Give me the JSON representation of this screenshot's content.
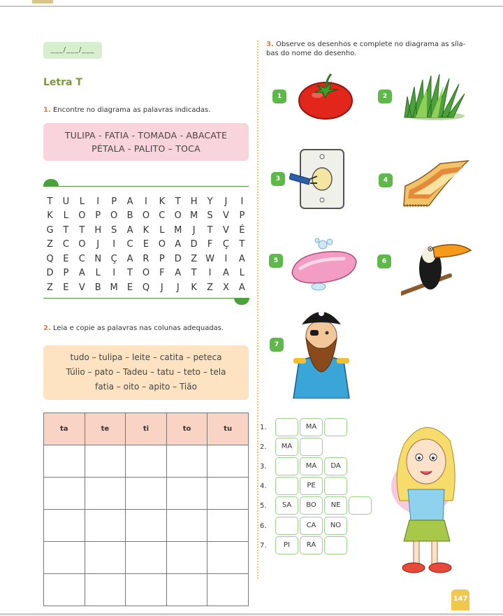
{
  "page": {
    "number": "147"
  },
  "header": {
    "date_placeholder": "___/___/___"
  },
  "section_title": "Letra T",
  "exercise1": {
    "number": "1.",
    "instruction": "Encontre no diagrama as palavras indicadas.",
    "words_line1": "TULIPA - FATIA - TOMADA - ABACATE",
    "words_line2": "PÉTALA - PALITO – TOCA",
    "grid": [
      [
        "T",
        "U",
        "L",
        "I",
        "P",
        "A",
        "I",
        "K",
        "T",
        "H",
        "Y",
        "J",
        "I"
      ],
      [
        "K",
        "L",
        "O",
        "P",
        "O",
        "B",
        "O",
        "C",
        "O",
        "M",
        "S",
        "V",
        "P"
      ],
      [
        "G",
        "T",
        "T",
        "H",
        "S",
        "A",
        "K",
        "L",
        "M",
        "J",
        "T",
        "V",
        "É"
      ],
      [
        "Z",
        "C",
        "O",
        "J",
        "I",
        "C",
        "E",
        "O",
        "A",
        "D",
        "F",
        "Ç",
        "T"
      ],
      [
        "Q",
        "E",
        "C",
        "N",
        "Ç",
        "A",
        "R",
        "P",
        "D",
        "Z",
        "W",
        "I",
        "A"
      ],
      [
        "D",
        "P",
        "A",
        "L",
        "I",
        "T",
        "O",
        "F",
        "A",
        "T",
        "I",
        "A",
        "L"
      ],
      [
        "Z",
        "E",
        "V",
        "B",
        "M",
        "E",
        "Q",
        "J",
        "J",
        "K",
        "Z",
        "X",
        "A"
      ]
    ]
  },
  "exercise2": {
    "number": "2.",
    "instruction": "Leia e copie as palavras nas colunas adequadas.",
    "words_line1": "tudo – tulipa – leite – catita – peteca",
    "words_line2": "Túlio – pato – Tadeu – tatu – teto – tela",
    "words_line3": "fatia – oito – apito – Tião",
    "columns": [
      "ta",
      "te",
      "ti",
      "to",
      "tu"
    ]
  },
  "exercise3": {
    "number": "3.",
    "instruction_line1": "Observe os desenhos e complete no diagrama as síla-",
    "instruction_line2": "bas do nome do desenho.",
    "picture_numbers": [
      "1",
      "2",
      "3",
      "4",
      "5",
      "6",
      "7"
    ],
    "pictures": [
      "tomato-illustration",
      "grass-illustration",
      "outlet-plug-illustration",
      "rug-illustration",
      "soap-illustration",
      "toucan-illustration",
      "pirate-illustration"
    ],
    "rows": [
      {
        "label": "1.",
        "cells": [
          "",
          "MA",
          ""
        ]
      },
      {
        "label": "2.",
        "cells": [
          "MA",
          ""
        ]
      },
      {
        "label": "3.",
        "cells": [
          "",
          "MA",
          "DA"
        ]
      },
      {
        "label": "4.",
        "cells": [
          "",
          "PE",
          ""
        ]
      },
      {
        "label": "5.",
        "cells": [
          "SA",
          "BO",
          "NE",
          ""
        ]
      },
      {
        "label": "6.",
        "cells": [
          "",
          "CA",
          "NO"
        ]
      },
      {
        "label": "7.",
        "cells": [
          "PI",
          "RA",
          ""
        ]
      }
    ]
  },
  "colors": {
    "accent_green": "#5fb84a",
    "pink_box": "#f9d4dc",
    "orange_box": "#fde3c2",
    "number_orange": "#e07a3a"
  }
}
